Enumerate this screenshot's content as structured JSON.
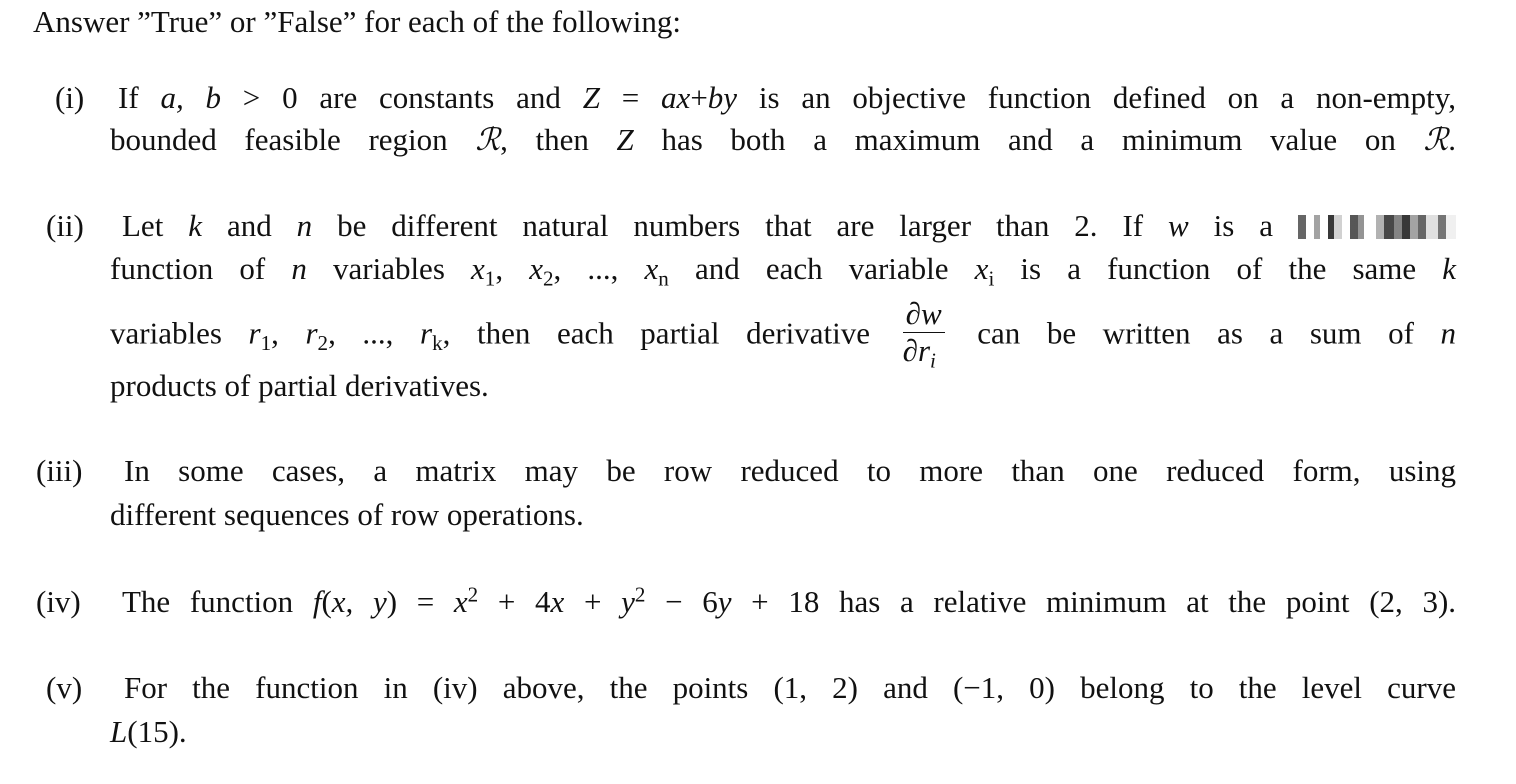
{
  "document": {
    "intro": "Answer ”True” or ”False” for each of the following:",
    "items": [
      {
        "label": "(i)",
        "lines": [
          {
            "t1": "If ",
            "m1": "a, b",
            "t2": " > 0 are constants and ",
            "m2": "Z",
            "t3": " = ",
            "m3": "ax",
            "t4": "+",
            "m4": "by",
            "t5": " is an objective function defined on a non-empty,"
          },
          {
            "t1": "bounded feasible region ",
            "m1": "ℛ",
            "t2": ", then ",
            "m2": "Z",
            "t3": " has both a maximum and a minimum value on ",
            "m3": "ℛ",
            "t4": "."
          }
        ]
      },
      {
        "label": "(ii)",
        "lines": [
          {
            "t1": "Let ",
            "m1": "k",
            "t2": " and ",
            "m2": "n",
            "t3": " be different natural numbers that are larger than 2.  If ",
            "m3": "w",
            "t4": " is a ",
            "redacted": "[redacted]"
          },
          {
            "t1": "function of ",
            "m1": "n",
            "t2": " variables ",
            "m2": "x",
            "s2": "1",
            "m3": "x",
            "s3": "2",
            "t3": ", ..., ",
            "m4": "x",
            "s4": "n",
            "t4": " and each variable ",
            "m5": "x",
            "s5": "i",
            "t5": " is a function of the same ",
            "m6": "k"
          },
          {
            "t1": "variables ",
            "m1": "r",
            "s1": "1",
            "m2": "r",
            "s2": "2",
            "t2": ", ..., ",
            "m3": "r",
            "s3": "k",
            "t3": ", then each partial derivative",
            "frac_num": "∂w",
            "frac_den": "∂r",
            "frac_den_sub": "i",
            "t4": "can be written as a sum of ",
            "m4": "n"
          },
          {
            "t1": "products of partial derivatives."
          }
        ]
      },
      {
        "label": "(iii)",
        "lines": [
          {
            "t1": "In some cases, a matrix may be row reduced to more than one reduced form, using"
          },
          {
            "t1": "different sequences of row operations."
          }
        ]
      },
      {
        "label": "(iv)",
        "lines": [
          {
            "t1": "The function ",
            "m1": "f",
            "t2": "(",
            "m2": "x, y",
            "t3": ") = ",
            "m3": "x",
            "p3": "2",
            "t4": " + 4",
            "m4": "x",
            "t5": " + ",
            "m5": "y",
            "p5": "2",
            "t6": " − 6",
            "m6": "y",
            "t7": " + 18 has a relative minimum at the point (2, 3)."
          }
        ]
      },
      {
        "label": "(v)",
        "lines": [
          {
            "t1": "For the function in (iv) above, the points (1, 2) and (−1, 0) belong to the level curve"
          },
          {
            "m1": "L",
            "t1": "(15)."
          }
        ]
      }
    ]
  }
}
